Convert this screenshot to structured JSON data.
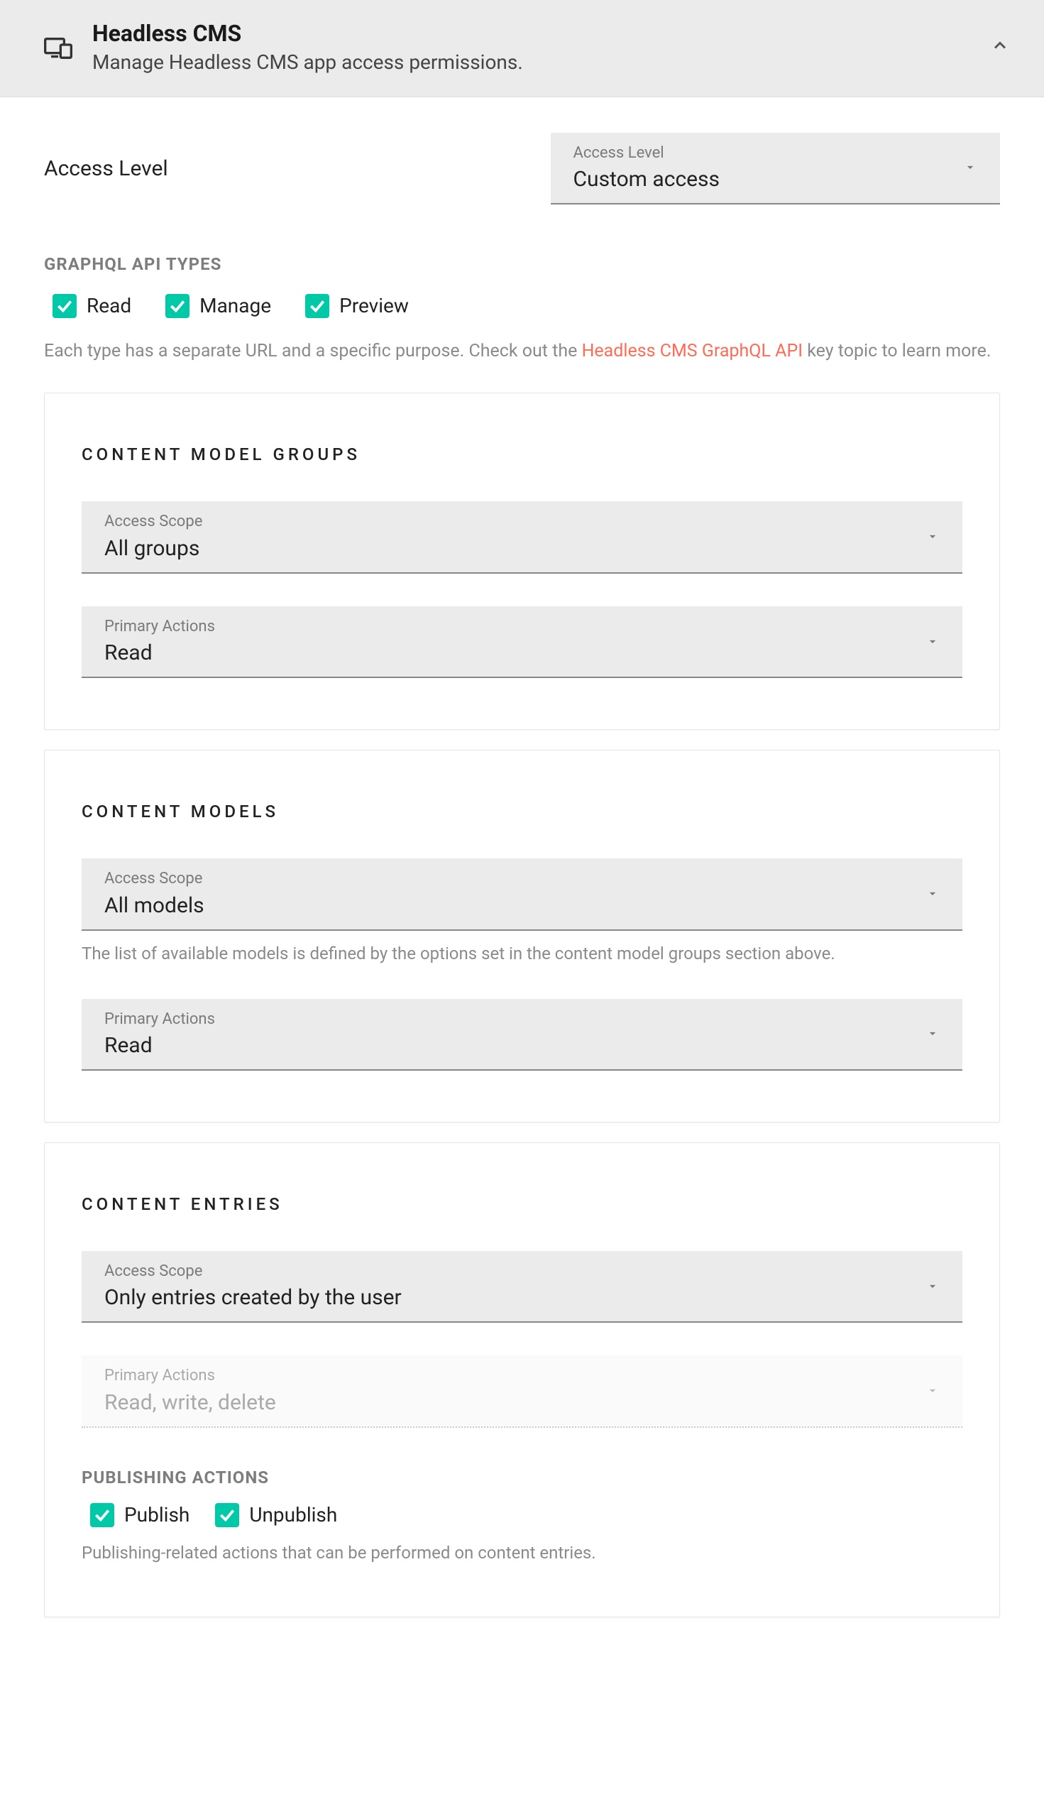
{
  "header": {
    "title": "Headless CMS",
    "subtitle": "Manage Headless CMS app access permissions."
  },
  "access_level": {
    "label": "Access Level",
    "field_label": "Access Level",
    "value": "Custom access"
  },
  "graphql": {
    "heading": "GraphQL API Types",
    "options": {
      "read": "Read",
      "manage": "Manage",
      "preview": "Preview"
    },
    "help_prefix": "Each type has a separate URL and a specific purpose. Check out the ",
    "help_link": "Headless CMS GraphQL API",
    "help_suffix": " key topic to learn more."
  },
  "groups": {
    "heading": "Content Model Groups",
    "scope_label": "Access Scope",
    "scope_value": "All groups",
    "actions_label": "Primary Actions",
    "actions_value": "Read"
  },
  "models": {
    "heading": "Content Models",
    "scope_label": "Access Scope",
    "scope_value": "All models",
    "help": "The list of available models is defined by the options set in the content model groups section above.",
    "actions_label": "Primary Actions",
    "actions_value": "Read"
  },
  "entries": {
    "heading": "Content Entries",
    "scope_label": "Access Scope",
    "scope_value": "Only entries created by the user",
    "actions_label": "Primary Actions",
    "actions_value": "Read, write, delete",
    "publishing_heading": "Publishing Actions",
    "publish": "Publish",
    "unpublish": "Unpublish",
    "publishing_help": "Publishing-related actions that can be performed on content entries."
  }
}
